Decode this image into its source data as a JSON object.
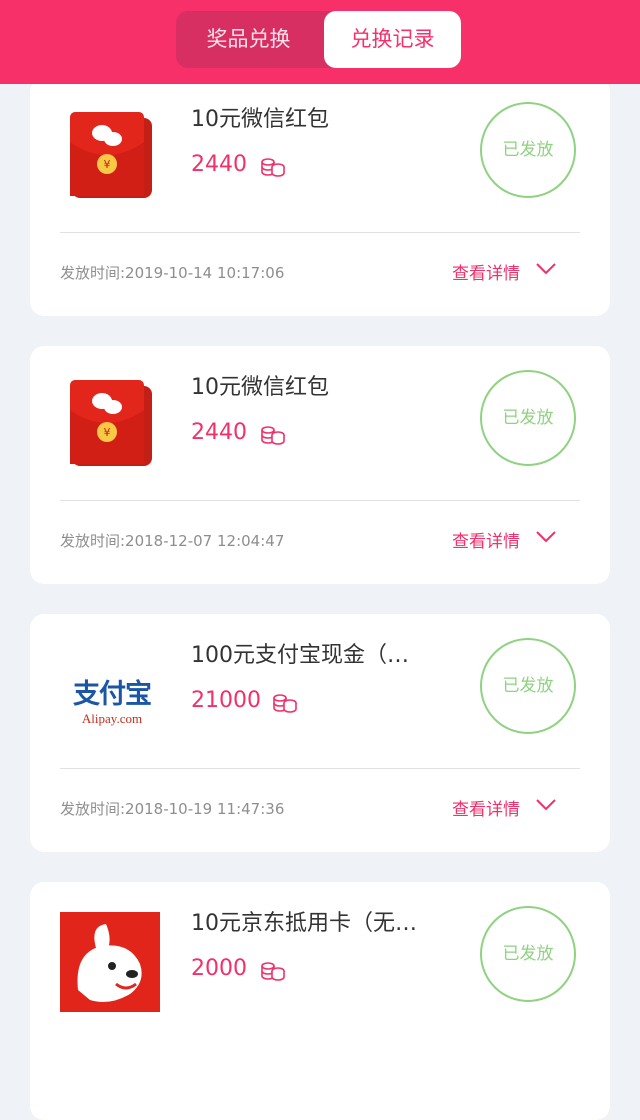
{
  "tabs": {
    "prizes": "奖品兑换",
    "records": "兑换记录"
  },
  "records": [
    {
      "title": "10元微信红包",
      "price": "2440",
      "status": "已发放",
      "time": "发放时间:2019-10-14 10:17:06",
      "detail": "查看详情",
      "icon": "wechat-red-envelope-icon"
    },
    {
      "title": "10元微信红包",
      "price": "2440",
      "status": "已发放",
      "time": "发放时间:2018-12-07 12:04:47",
      "detail": "查看详情",
      "icon": "wechat-red-envelope-icon"
    },
    {
      "title": "100元支付宝现金（…",
      "price": "21000",
      "status": "已发放",
      "time": "发放时间:2018-10-19 11:47:36",
      "detail": "查看详情",
      "icon": "alipay-logo",
      "logo_text": "支付宝",
      "logo_sub": "Alipay.com"
    },
    {
      "title": "10元京东抵用卡（无…",
      "price": "2000",
      "status": "已发放",
      "icon": "jd-joy-dog-icon"
    }
  ],
  "colors": {
    "brand": "#f7306a",
    "status_green": "#8fd281",
    "background": "#eff2f6"
  }
}
